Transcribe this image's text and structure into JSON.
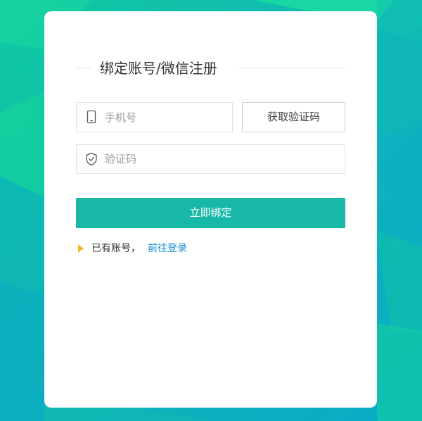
{
  "title": "绑定账号/微信注册",
  "phone_input": {
    "icon": "phone-icon",
    "placeholder": "手机号",
    "value": ""
  },
  "get_code_button": {
    "label": "获取验证码"
  },
  "code_input": {
    "icon": "shield-check-icon",
    "placeholder": "验证码",
    "value": ""
  },
  "bind_button": {
    "label": "立即绑定"
  },
  "login_prompt": {
    "text": "已有账号，",
    "link_label": "前往登录"
  },
  "colors": {
    "primary": "#17b8a8",
    "link": "#1a90d6",
    "arrow": "#f4b72b",
    "background_start": "#12c9a0",
    "background_end": "#0aa9c8"
  }
}
